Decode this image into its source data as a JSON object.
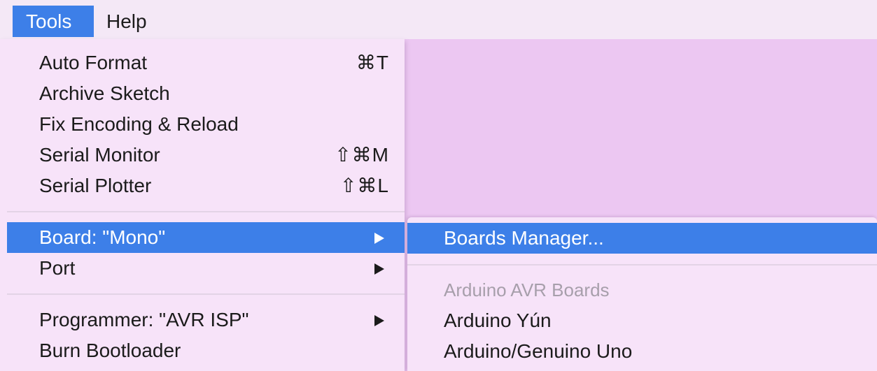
{
  "menubar": {
    "tools_label": "Tools",
    "help_label": "Help"
  },
  "tools_menu": {
    "items": [
      {
        "label": "Auto Format",
        "shortcut": "⌘T"
      },
      {
        "label": "Archive Sketch",
        "shortcut": ""
      },
      {
        "label": "Fix Encoding & Reload",
        "shortcut": ""
      },
      {
        "label": "Serial Monitor",
        "shortcut": "⇧⌘M"
      },
      {
        "label": "Serial Plotter",
        "shortcut": "⇧⌘L"
      },
      {
        "label": "Board: \"Mono\"",
        "submenu": true,
        "highlighted": true
      },
      {
        "label": "Port",
        "submenu": true
      },
      {
        "label": "Programmer: \"AVR ISP\"",
        "submenu": true
      },
      {
        "label": "Burn Bootloader",
        "shortcut": ""
      }
    ]
  },
  "board_submenu": {
    "manager_label": "Boards Manager...",
    "section_header": "Arduino AVR Boards",
    "boards": [
      "Arduino Yún",
      "Arduino/Genuino Uno"
    ]
  },
  "colors": {
    "highlight": "#3d7fe8",
    "menu_background": "#f7e3f9",
    "backdrop": "#ecc7f2"
  }
}
